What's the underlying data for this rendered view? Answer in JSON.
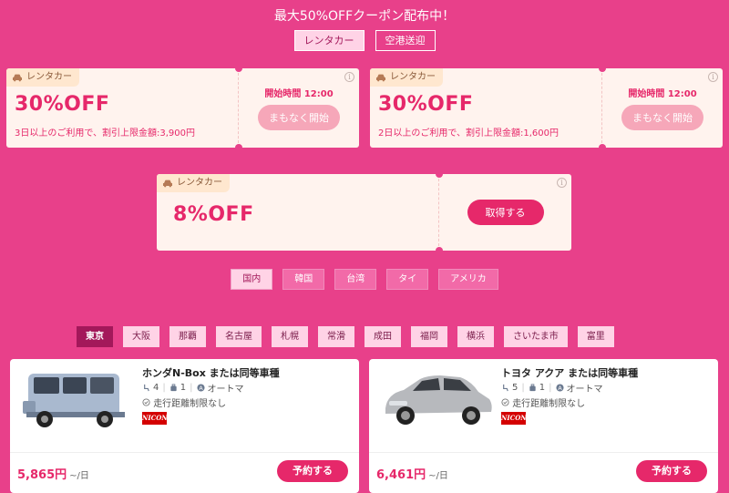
{
  "headline": "最大50%OFFクーポン配布中！",
  "category_tabs": [
    {
      "label": "レンタカー",
      "active": true
    },
    {
      "label": "空港送迎",
      "active": false
    }
  ],
  "coupons": [
    {
      "tag": "レンタカー",
      "discount": "30%OFF",
      "condition": "3日以上のご利用で、割引上限金額:3,900円",
      "start_time": "開始時間 12:00",
      "button": "まもなく開始"
    },
    {
      "tag": "レンタカー",
      "discount": "30%OFF",
      "condition": "2日以上のご利用で、割引上限金額:1,600円",
      "start_time": "開始時間 12:00",
      "button": "まもなく開始"
    },
    {
      "tag": "レンタカー",
      "discount": "8%OFF",
      "button": "取得する"
    }
  ],
  "info_glyph": "i",
  "countries": [
    {
      "label": "国内",
      "active": true
    },
    {
      "label": "韓国",
      "active": false
    },
    {
      "label": "台湾",
      "active": false
    },
    {
      "label": "タイ",
      "active": false
    },
    {
      "label": "アメリカ",
      "active": false
    }
  ],
  "cities": [
    {
      "label": "東京",
      "active": true
    },
    {
      "label": "大阪"
    },
    {
      "label": "那覇"
    },
    {
      "label": "名古屋"
    },
    {
      "label": "札幌"
    },
    {
      "label": "常滑"
    },
    {
      "label": "成田"
    },
    {
      "label": "福岡"
    },
    {
      "label": "横浜"
    },
    {
      "label": "さいたま市"
    },
    {
      "label": "富里"
    }
  ],
  "cars": [
    {
      "name": "ホンダN-Box または同等車種",
      "seats": "4",
      "luggage": "1",
      "transmission": "オートマ",
      "mileage": "走行距離制限なし",
      "brand": "NICONICO",
      "price": "5,865円",
      "unit": "~/日",
      "button": "予約する",
      "body_color": "#a9b9cf"
    },
    {
      "name": "トヨタ アクア または同等車種",
      "seats": "5",
      "luggage": "1",
      "transmission": "オートマ",
      "mileage": "走行距離制限なし",
      "brand": "NICONICO",
      "price": "6,461円",
      "unit": "~/日",
      "button": "予約する",
      "body_color": "#b7b9bd"
    }
  ],
  "colors": {
    "background": "#e8408a",
    "accent": "#e6286a",
    "coupon_bg": "#fff3ee",
    "tag_bg": "#ffe7cf"
  }
}
